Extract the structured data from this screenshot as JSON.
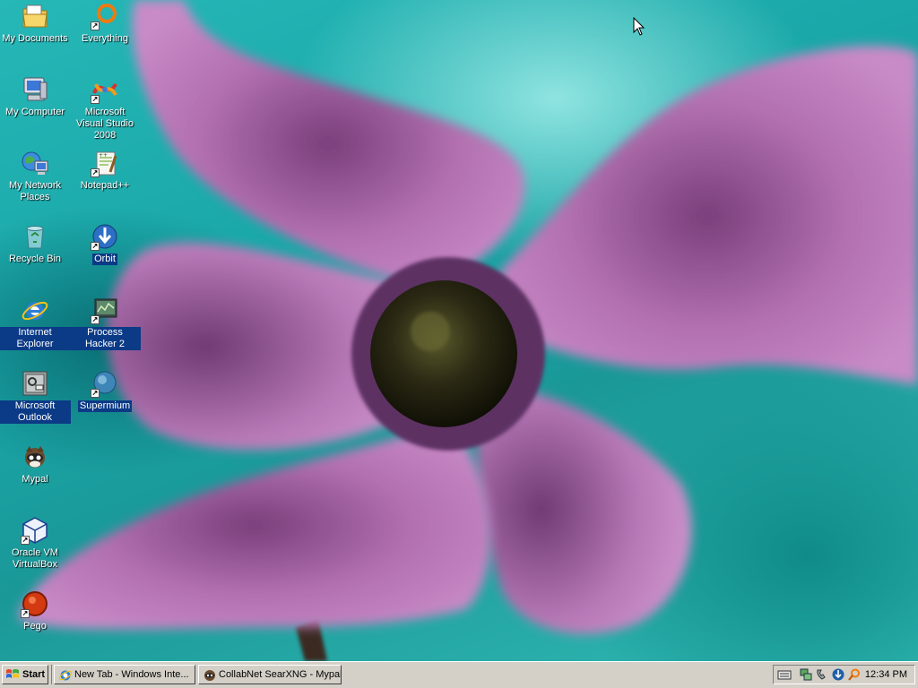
{
  "desktop": {
    "icons": [
      {
        "label": "My Documents",
        "icon": "my-documents-icon"
      },
      {
        "label": "My Computer",
        "icon": "my-computer-icon"
      },
      {
        "label": "My Network Places",
        "icon": "my-network-places-icon"
      },
      {
        "label": "Recycle Bin",
        "icon": "recycle-bin-icon"
      },
      {
        "label": "Internet Explorer",
        "icon": "internet-explorer-icon"
      },
      {
        "label": "Microsoft Outlook",
        "icon": "outlook-icon"
      },
      {
        "label": "Mypal",
        "icon": "mypal-icon"
      },
      {
        "label": "Oracle VM VirtualBox",
        "icon": "virtualbox-icon"
      },
      {
        "label": "Pego",
        "icon": "pego-icon"
      },
      {
        "label": "Everything",
        "icon": "everything-icon"
      },
      {
        "label": "Microsoft Visual Studio 2008",
        "icon": "visual-studio-icon"
      },
      {
        "label": "Notepad++",
        "icon": "notepad-plus-plus-icon"
      },
      {
        "label": "Orbit",
        "icon": "orbit-icon"
      },
      {
        "label": "Process Hacker 2",
        "icon": "process-hacker-icon"
      },
      {
        "label": "Supermium",
        "icon": "supermium-icon"
      }
    ]
  },
  "taskbar": {
    "start_label": "Start",
    "tasks": [
      {
        "label": "New Tab - Windows Inte...",
        "icon": "internet-explorer-icon"
      },
      {
        "label": "CollabNet SearXNG - Mypal",
        "icon": "mypal-icon"
      }
    ],
    "tray_icons": [
      "keyboard-icon",
      "network-icon",
      "phone-icon",
      "orbit-tray-icon",
      "everything-tray-icon"
    ],
    "clock": "12:34 PM"
  },
  "colors": {
    "selection": "#0b3a86",
    "taskbar": "#d4d0c8",
    "wallpaper_teal": "#1aa7a8",
    "flower_purple": "#b06fae"
  }
}
